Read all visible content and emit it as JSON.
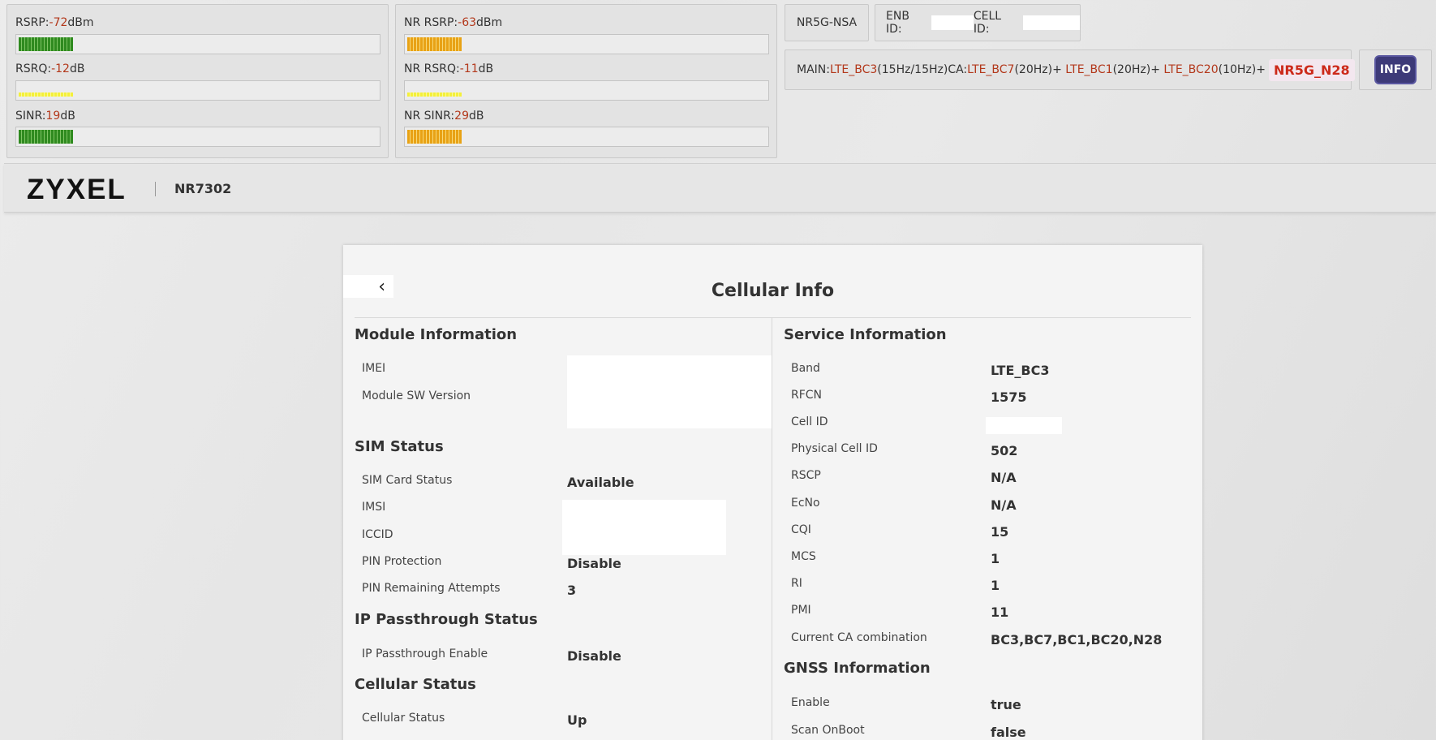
{
  "signal": {
    "lte": {
      "rsrp": {
        "label": "RSRP:",
        "value": "-72",
        "unit": "dBm",
        "level": 0.15
      },
      "rsrq": {
        "label": "RSRQ:",
        "value": "-12",
        "unit": "dB",
        "level": 0.15
      },
      "sinr": {
        "label": "SINR:",
        "value": "19",
        "unit": "dB",
        "level": 0.15
      }
    },
    "nr": {
      "rsrp": {
        "label": "NR RSRP:",
        "value": "-63",
        "unit": "dBm",
        "level": 0.15
      },
      "rsrq": {
        "label": "NR RSRQ:",
        "value": "-11",
        "unit": "dB",
        "level": 0.15
      },
      "sinr": {
        "label": "NR SINR:",
        "value": "29",
        "unit": "dB",
        "level": 0.15
      }
    }
  },
  "status": {
    "mode": "NR5G-NSA",
    "enb_id_label": "ENB ID:",
    "cell_id_label": "CELL ID:"
  },
  "carrier": {
    "main_label": "MAIN:",
    "main_band": "LTE_BC3",
    "main_bw": "(15Hz/15Hz)",
    "ca_label": "CA:",
    "ca": [
      {
        "band": "LTE_BC7",
        "bw": "(20Hz)",
        "sep": "+"
      },
      {
        "band": "LTE_BC1",
        "bw": "(20Hz)",
        "sep": "+"
      },
      {
        "band": "LTE_BC20",
        "bw": "(10Hz)",
        "sep": "+"
      }
    ],
    "nr_band": "NR5G_N28",
    "info_button": "INFO"
  },
  "header": {
    "logo": "ZYXEL",
    "model": "NR7302"
  },
  "page": {
    "back_icon": "‹",
    "title": "Cellular Info"
  },
  "module_info": {
    "title": "Module Information",
    "rows": [
      {
        "label": "IMEI",
        "value": ""
      },
      {
        "label": "Module SW Version",
        "value": ""
      }
    ]
  },
  "sim_status": {
    "title": "SIM Status",
    "rows": [
      {
        "label": "SIM Card Status",
        "value": "Available"
      },
      {
        "label": "IMSI",
        "value": ""
      },
      {
        "label": "ICCID",
        "value": ""
      },
      {
        "label": "PIN Protection",
        "value": "Disable"
      },
      {
        "label": "PIN Remaining Attempts",
        "value": "3"
      }
    ]
  },
  "ip_passthrough": {
    "title": "IP Passthrough Status",
    "rows": [
      {
        "label": "IP Passthrough Enable",
        "value": "Disable"
      }
    ]
  },
  "cellular_status": {
    "title": "Cellular Status",
    "rows": [
      {
        "label": "Cellular Status",
        "value": "Up"
      }
    ]
  },
  "service_info": {
    "title": "Service Information",
    "rows": [
      {
        "label": "Band",
        "value": "LTE_BC3"
      },
      {
        "label": "RFCN",
        "value": "1575"
      },
      {
        "label": "Cell ID",
        "value": ""
      },
      {
        "label": "Physical Cell ID",
        "value": "502"
      },
      {
        "label": "RSCP",
        "value": "N/A"
      },
      {
        "label": "EcNo",
        "value": "N/A"
      },
      {
        "label": "CQI",
        "value": "15"
      },
      {
        "label": "MCS",
        "value": "1"
      },
      {
        "label": "RI",
        "value": "1"
      },
      {
        "label": "PMI",
        "value": "11"
      },
      {
        "label": "Current CA combination",
        "value": "BC3,BC7,BC1,BC20,N28"
      }
    ]
  },
  "gnss_info": {
    "title": "GNSS Information",
    "rows": [
      {
        "label": "Enable",
        "value": "true"
      },
      {
        "label": "Scan OnBoot",
        "value": "false"
      }
    ]
  }
}
